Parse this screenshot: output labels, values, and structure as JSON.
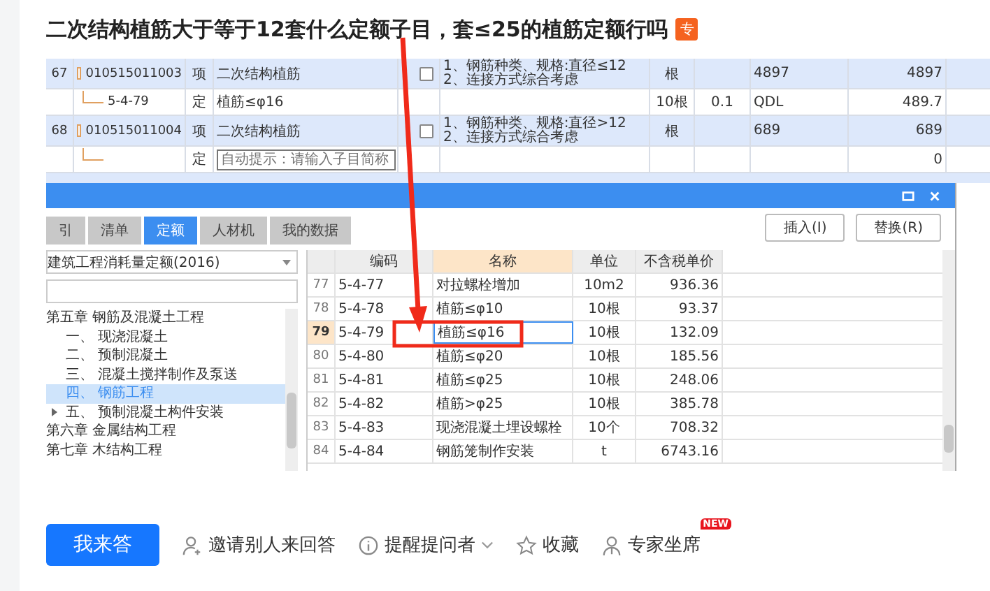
{
  "question": {
    "title": "二次结构植筋大于等于12套什么定额子目，套≤25的植筋定额行吗",
    "badge": "专"
  },
  "screenshot": {
    "bill_rows": [
      {
        "kind": "item",
        "no": "67",
        "code": "010515011003",
        "type": "项",
        "name": "二次结构植筋",
        "checked": false,
        "desc": [
          "1、钢筋种类、规格:直径≤12",
          "2、连接方式综合考虑"
        ],
        "unit": "根",
        "qty": "",
        "c9": "4897",
        "c10": "4897"
      },
      {
        "kind": "sub",
        "no": "",
        "code": "5-4-79",
        "type": "定",
        "name": "植筋≤φ16",
        "unit": "10根",
        "qty": "0.1",
        "c9": "QDL",
        "c10": "489.7"
      },
      {
        "kind": "item",
        "no": "68",
        "code": "010515011004",
        "type": "项",
        "name": "二次结构植筋",
        "checked": false,
        "desc": [
          "1、钢筋种类、规格:直径>12",
          "2、连接方式综合考虑"
        ],
        "unit": "根",
        "qty": "",
        "c9": "689",
        "c10": "689"
      },
      {
        "kind": "input",
        "no": "",
        "code": "",
        "type": "定",
        "placeholder": "自动提示：请输入子目简称",
        "unit": "",
        "qty": "",
        "c9": "",
        "c10": "0"
      }
    ],
    "dialog": {
      "tabs": [
        {
          "label": "引",
          "selected": false
        },
        {
          "label": "清单",
          "selected": false
        },
        {
          "label": "定额",
          "selected": true
        },
        {
          "label": "人材机",
          "selected": false
        },
        {
          "label": "我的数据",
          "selected": false
        }
      ],
      "buttons": [
        "插入(I)",
        "替换(R)"
      ],
      "library": "建筑工程消耗量定额(2016)",
      "tree": [
        {
          "label": "第五章 钢筋及混凝土工程",
          "selected": false,
          "collapsed": false,
          "children": [
            {
              "label": "一、 现浇混凝土",
              "selected": false,
              "collapsed": false
            },
            {
              "label": "二、 预制混凝土",
              "selected": false,
              "collapsed": false
            },
            {
              "label": "三、 混凝土搅拌制作及泵送",
              "selected": false,
              "collapsed": false
            },
            {
              "label": "四、 钢筋工程",
              "selected": true,
              "collapsed": false
            },
            {
              "label": "五、 预制混凝土构件安装",
              "selected": false,
              "collapsed": true
            }
          ]
        },
        {
          "label": "第六章 金属结构工程",
          "selected": false,
          "collapsed": false
        },
        {
          "label": "第七章 木结构工程",
          "selected": false,
          "collapsed": false
        }
      ],
      "columns": [
        "编码",
        "名称",
        "单位",
        "不含税单价"
      ],
      "rows": [
        {
          "no": "77",
          "code": "5-4-77",
          "name": "对拉螺栓增加",
          "unit": "10m2",
          "price": "936.36",
          "selected": false
        },
        {
          "no": "78",
          "code": "5-4-78",
          "name": "植筋≤φ10",
          "unit": "10根",
          "price": "93.37",
          "selected": false
        },
        {
          "no": "79",
          "code": "5-4-79",
          "name": "植筋≤φ16",
          "unit": "10根",
          "price": "132.09",
          "selected": true
        },
        {
          "no": "80",
          "code": "5-4-80",
          "name": "植筋≤φ20",
          "unit": "10根",
          "price": "185.56",
          "selected": false
        },
        {
          "no": "81",
          "code": "5-4-81",
          "name": "植筋≤φ25",
          "unit": "10根",
          "price": "248.06",
          "selected": false
        },
        {
          "no": "82",
          "code": "5-4-82",
          "name": "植筋>φ25",
          "unit": "10根",
          "price": "385.78",
          "selected": false
        },
        {
          "no": "83",
          "code": "5-4-83",
          "name": "现浇混凝土埋设螺栓",
          "unit": "10个",
          "price": "708.32",
          "selected": false
        },
        {
          "no": "84",
          "code": "5-4-84",
          "name": "钢筋笼制作安装",
          "unit": "t",
          "price": "6743.16",
          "selected": false
        }
      ]
    }
  },
  "actions": {
    "answer": "我来答",
    "items": [
      {
        "kind": "invite",
        "label": "邀请别人来回答"
      },
      {
        "kind": "remind",
        "label": "提醒提问者"
      },
      {
        "kind": "favorite",
        "label": "收藏"
      },
      {
        "kind": "expert",
        "label": "专家坐席",
        "badge": "NEW"
      }
    ]
  }
}
